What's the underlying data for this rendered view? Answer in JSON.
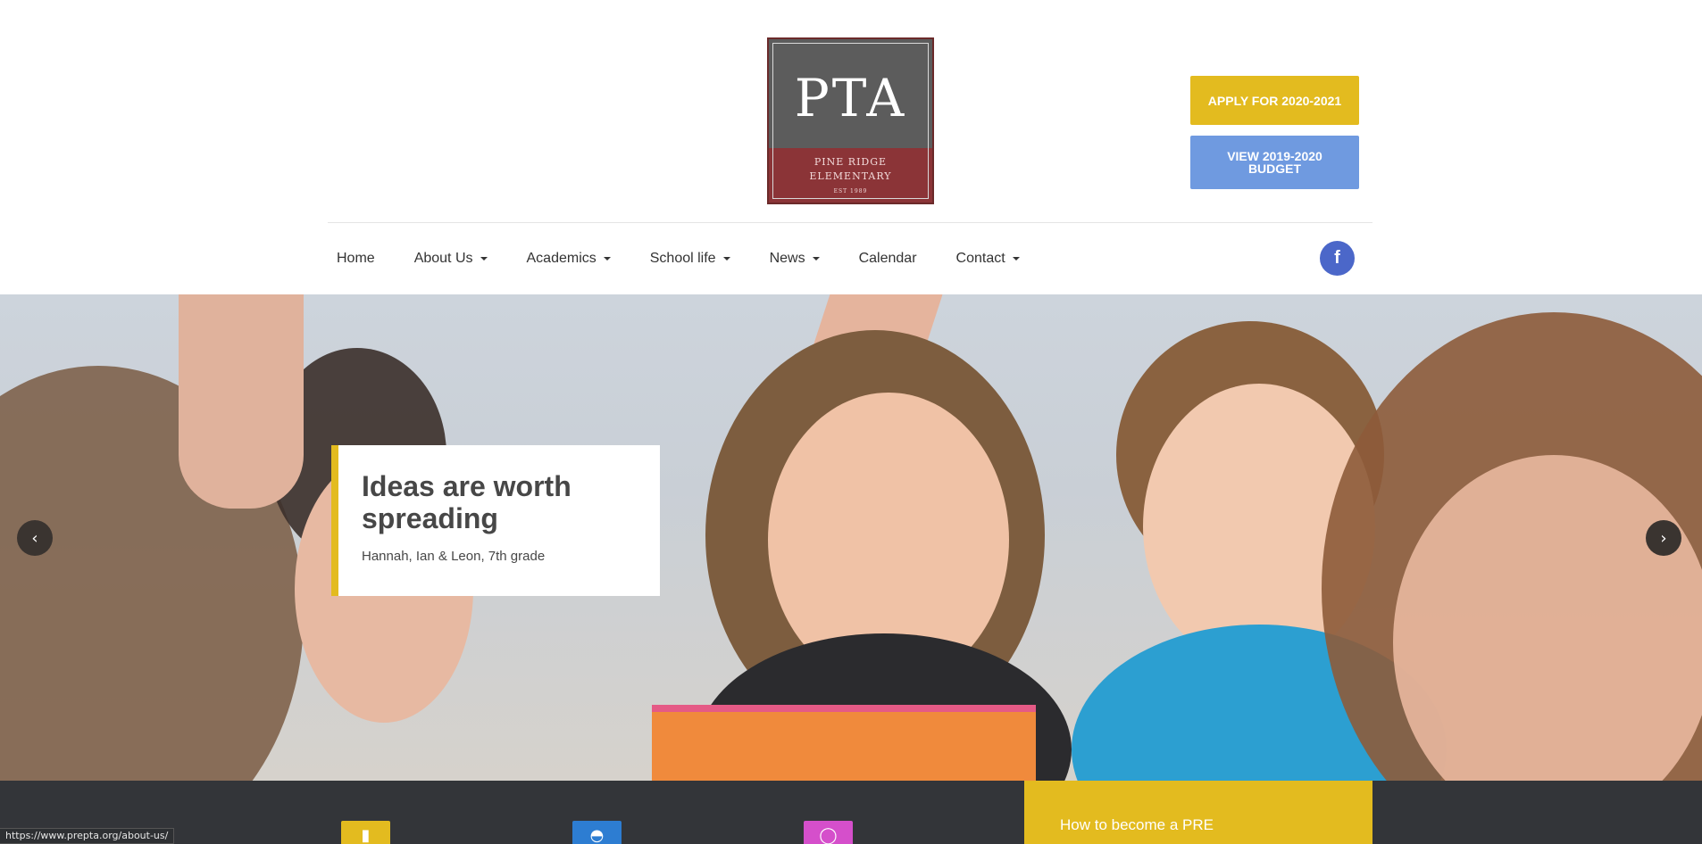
{
  "logo": {
    "title": "PTA",
    "school_line_1": "PINE RIDGE",
    "school_line_2": "ELEMENTARY",
    "est": "EST 1989"
  },
  "header_buttons": {
    "apply": "APPLY FOR 2020-2021",
    "budget": "VIEW 2019-2020 BUDGET"
  },
  "nav": {
    "items": [
      {
        "label": "Home",
        "dropdown": false
      },
      {
        "label": "About Us",
        "dropdown": true
      },
      {
        "label": "Academics",
        "dropdown": true
      },
      {
        "label": "School life",
        "dropdown": true
      },
      {
        "label": "News",
        "dropdown": true
      },
      {
        "label": "Calendar",
        "dropdown": false
      },
      {
        "label": "Contact",
        "dropdown": true
      }
    ],
    "social_icon": "facebook-icon",
    "social_glyph": "f"
  },
  "hero": {
    "headline": "Ideas are worth spreading",
    "subline": "Hannah, Ian & Leon, 7th grade",
    "prev_glyph": "‹",
    "next_glyph": "›"
  },
  "features": {
    "panel_text": "How to become a PRE"
  },
  "statusbar": {
    "url": "https://www.prepta.org/about-us/"
  },
  "colors": {
    "accent_yellow": "#e3bb1f",
    "accent_blue": "#6f9ae0",
    "facebook_blue": "#4b67c9",
    "dark_band": "#333539",
    "logo_red": "#8b3437"
  }
}
